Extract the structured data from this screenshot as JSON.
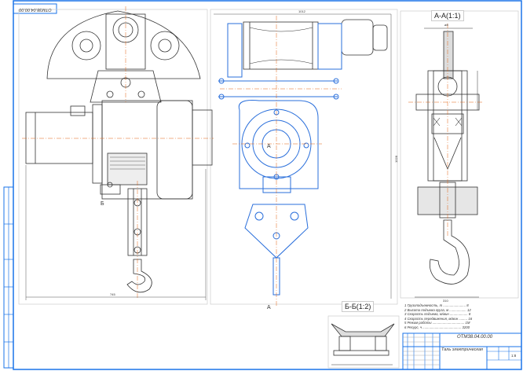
{
  "drawing": {
    "stamp_code": "ОТМ38.04.00.00",
    "section_aa_label": "А-А(1:1)",
    "section_bb_label": "Б-Б(1:2)",
    "cut_mark_a": "А",
    "cut_mark_b": "Б",
    "dimensions": {
      "overall_width": "745",
      "mid_width": "1012",
      "height": "1028",
      "aa_width": "ø8",
      "aa_bottom": "310"
    },
    "notes": [
      "1 Грузоподъемность, т ........................ 8",
      "2 Высота подъема груза, м .................. 12",
      "3 Скорость подъема, м/мин ................... 8",
      "4 Скорость передвижения, м/мин ......... 16",
      "5 Режим работы .................................. 1М",
      "6 Ресурс, ч ......................................... 3200"
    ],
    "title_block": {
      "code": "ОТМ38.04.00.00",
      "name": "Таль электрическая",
      "scale": "1:8"
    },
    "colors": {
      "frame": "#1a73e8",
      "lines": "#222222",
      "accent_parts": "#2a6fdb",
      "axis": "#e06010"
    }
  }
}
